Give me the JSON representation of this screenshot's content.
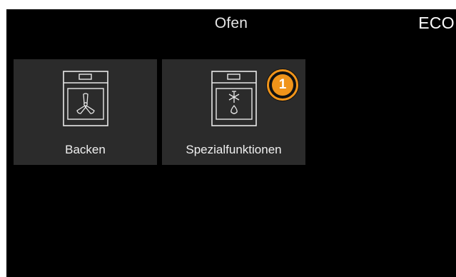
{
  "header": {
    "title": "Ofen",
    "eco_label": "ECO"
  },
  "tiles": [
    {
      "label": "Backen",
      "icon": "oven-fan-icon"
    },
    {
      "label": "Spezialfunktionen",
      "icon": "oven-special-function-icon",
      "badge": "1"
    }
  ],
  "colors": {
    "background": "#000000",
    "tile": "#2b2b2b",
    "accent": "#f0941a",
    "text": "#f0f0f0"
  }
}
